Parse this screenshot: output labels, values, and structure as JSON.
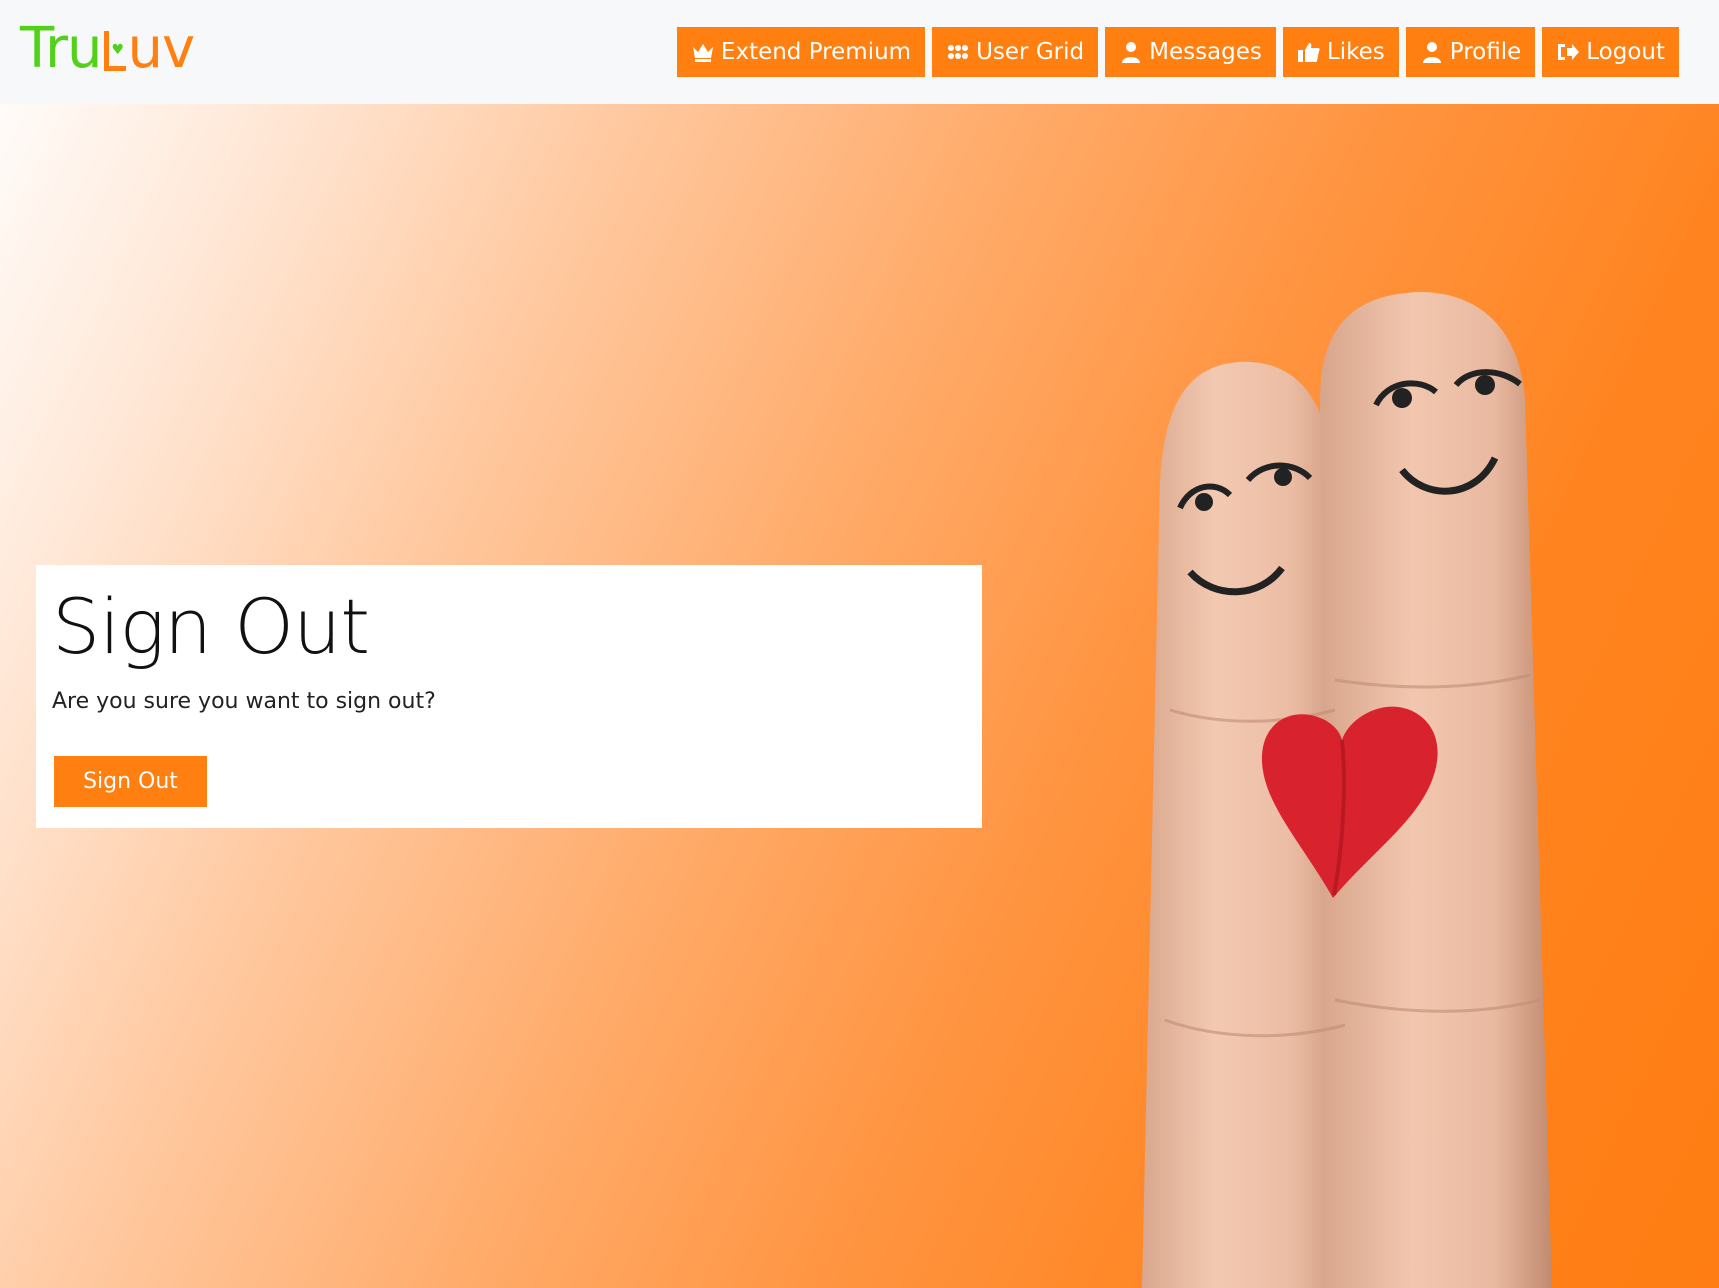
{
  "brand": {
    "part1": "Tru",
    "part2": "uv",
    "heart": "♥"
  },
  "nav": [
    {
      "label": "Extend Premium",
      "icon": "crown-icon"
    },
    {
      "label": "User Grid",
      "icon": "grid-icon"
    },
    {
      "label": "Messages",
      "icon": "user-icon"
    },
    {
      "label": "Likes",
      "icon": "thumbs-up-icon"
    },
    {
      "label": "Profile",
      "icon": "user-icon"
    },
    {
      "label": "Logout",
      "icon": "sign-out-icon"
    }
  ],
  "card": {
    "title": "Sign Out",
    "message": "Are you sure you want to sign out?",
    "button_label": "Sign Out"
  },
  "colors": {
    "accent": "#ff7f11",
    "brand_green": "#53d11a",
    "navbar_bg": "#f7f8fa"
  }
}
